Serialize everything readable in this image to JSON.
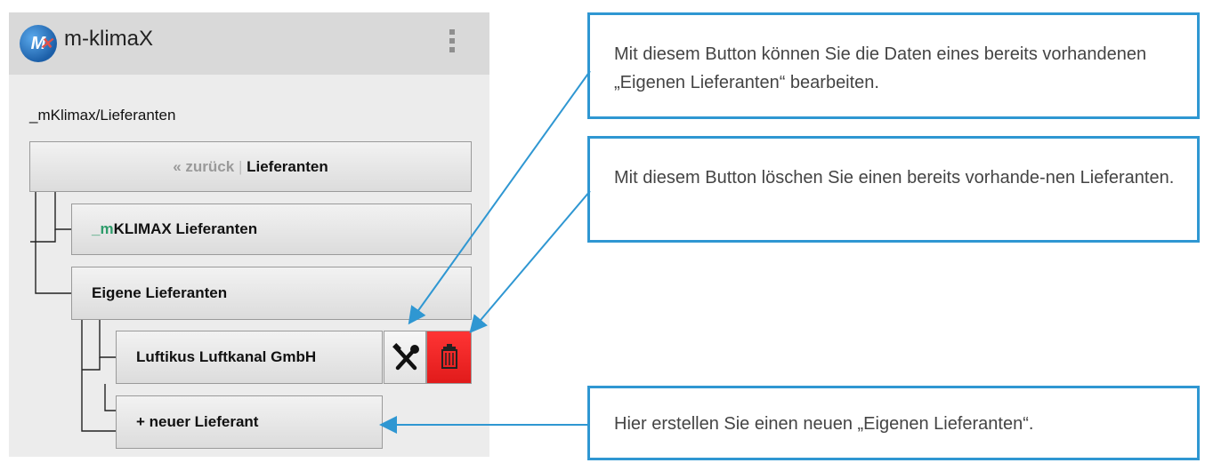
{
  "app": {
    "title": "m-klimaX",
    "logo_icon": "m-klimax-logo"
  },
  "breadcrumb": "_mKlimax/Lieferanten",
  "nav": {
    "back_label": "« zurück",
    "separator": "|",
    "current_label": "Lieferanten"
  },
  "tree": {
    "mk_prefix": "_m",
    "mk_label": "KLIMAX Lieferanten",
    "own_label": "Eigene Lieferanten",
    "supplier_name": "Luftikus Luftkanal GmbH",
    "new_label": "+ neuer Lieferant"
  },
  "callouts": {
    "edit": "Mit diesem Button können Sie die Daten eines bereits vorhandenen „Eigenen Lieferanten“ bearbeiten.",
    "delete": "Mit diesem Button löschen Sie einen bereits vorhande-nen Lieferanten.",
    "new": "Hier erstellen Sie einen neuen „Eigenen Lieferanten“."
  },
  "colors": {
    "accent": "#2f97d2",
    "delete": "#e11b1b",
    "green": "#2e9c6b"
  }
}
